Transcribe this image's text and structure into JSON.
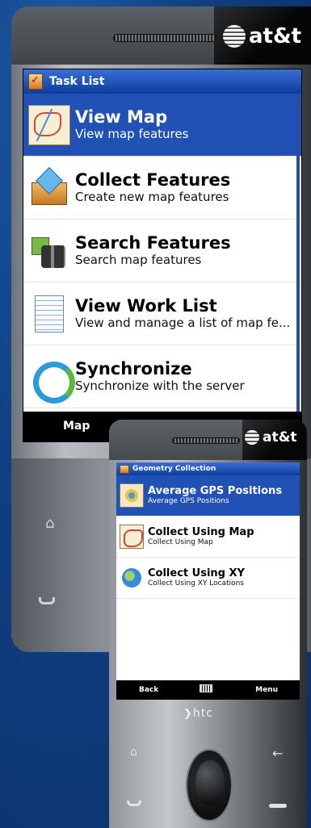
{
  "phone1": {
    "carrier": "at&t",
    "title": "Task List",
    "items": [
      {
        "title": "View Map",
        "subtitle": "View map features",
        "icon": "map-icon",
        "selected": true
      },
      {
        "title": "Collect Features",
        "subtitle": "Create new map features",
        "icon": "box-icon",
        "selected": false
      },
      {
        "title": "Search Features",
        "subtitle": "Search map features",
        "icon": "binoculars-icon",
        "selected": false
      },
      {
        "title": "View Work List",
        "subtitle": "View and manage a list of map fe...",
        "icon": "document-icon",
        "selected": false
      },
      {
        "title": "Synchronize",
        "subtitle": "Synchronize with the server",
        "icon": "sync-icon",
        "selected": false
      }
    ],
    "softkey_left": "Map"
  },
  "phone2": {
    "carrier": "at&t",
    "title": "Geometry Collection",
    "items": [
      {
        "title": "Average GPS Positions",
        "subtitle": "Average GPS Positions",
        "icon": "gps-icon",
        "selected": true
      },
      {
        "title": "Collect Using Map",
        "subtitle": "Collect Using Map",
        "icon": "map-icon",
        "selected": false
      },
      {
        "title": "Collect Using XY",
        "subtitle": "Collect Using XY Locations",
        "icon": "globe-icon",
        "selected": false
      }
    ],
    "softkey_left": "Back",
    "softkey_right": "Menu",
    "brand": "htc"
  },
  "colors": {
    "selection": "#2251b6",
    "titlebar": "#0d3c9c",
    "background": "#0f3f82"
  }
}
